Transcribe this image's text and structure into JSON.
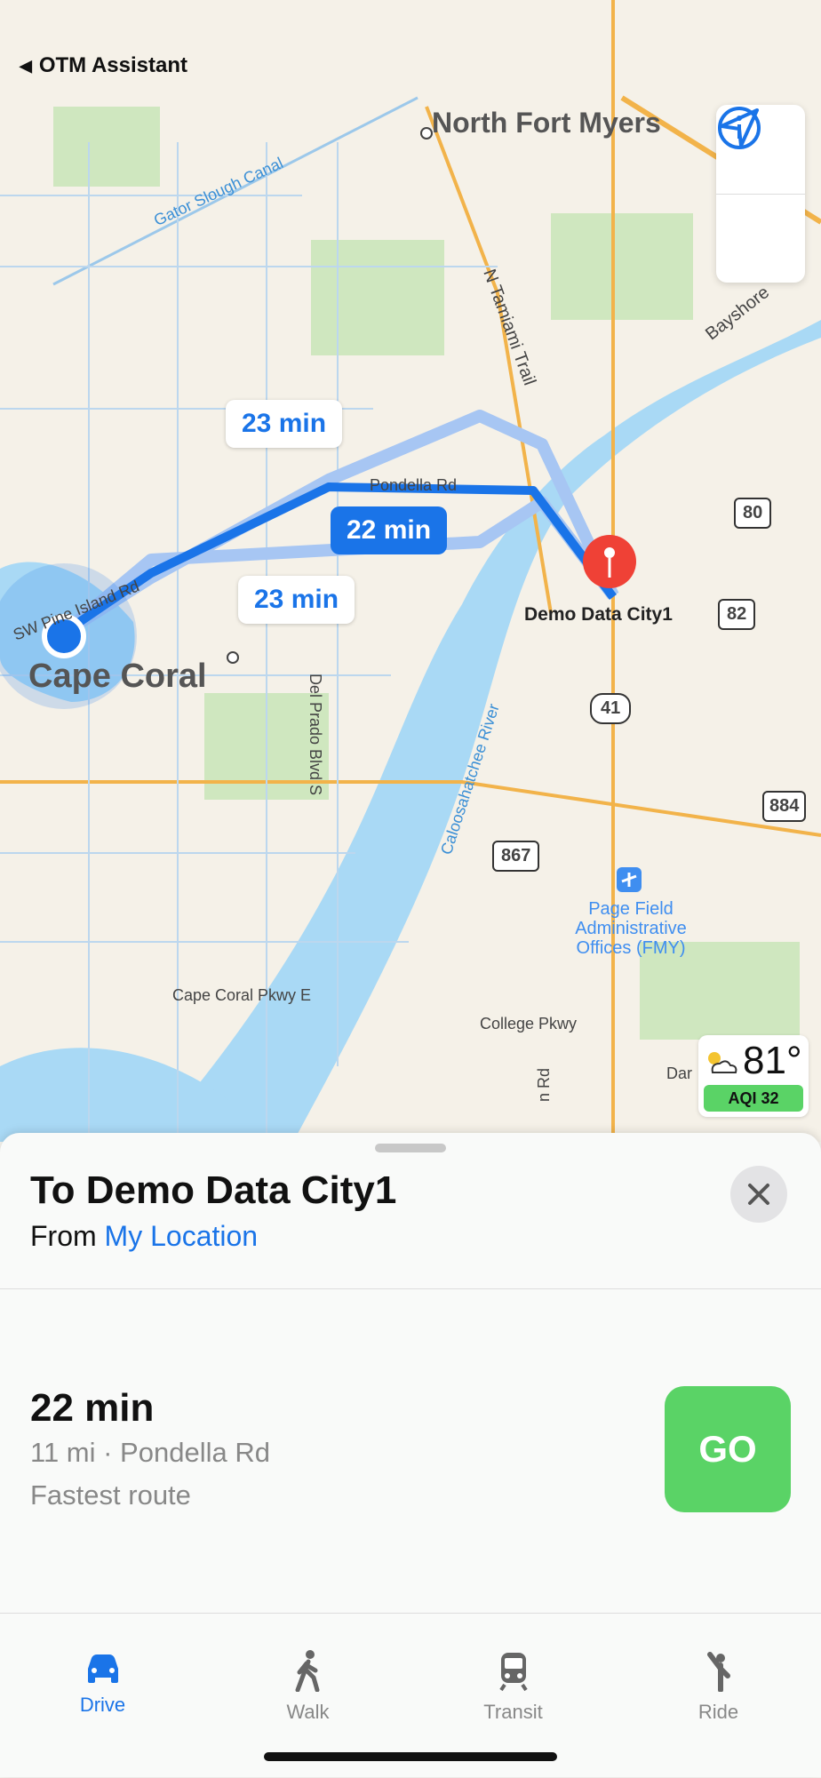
{
  "status_bar": {
    "back_label": "OTM Assistant"
  },
  "map": {
    "labels": {
      "north_fort_myers": "North Fort Myers",
      "gator_canal": "Gator Slough Canal",
      "tamiami": "N Tamiami Trail",
      "bayshore": "Bayshore",
      "pondella_rd": "Pondella Rd",
      "pine_island": "SW Pine Island Rd",
      "cape_coral": "Cape Coral",
      "del_prado": "Del Prado Blvd S",
      "river": "Caloosahatchee River",
      "airport": [
        "Page Field",
        "Administrative",
        "Offices (FMY)"
      ],
      "cape_coral_pkwy": "Cape Coral Pkwy E",
      "college_pkwy": "College Pkwy",
      "destination_pin": "Demo Data City1",
      "dar": "Dar",
      "rd": "n Rd"
    },
    "shields": [
      "80",
      "82",
      "41",
      "884",
      "867"
    ],
    "etas": {
      "alt1": "23 min",
      "main": "22 min",
      "alt2": "23 min"
    },
    "weather": {
      "temp": "81°",
      "aqi": "AQI 32"
    },
    "colors": {
      "route": "#1a74e8",
      "alt_route": "#a7c6f3",
      "water": "#a9d9f5"
    }
  },
  "sheet": {
    "title": "To Demo Data City1",
    "from_prefix": "From",
    "from_link": "My Location",
    "route": {
      "time": "22 min",
      "details": "11 mi · Pondella Rd",
      "note": "Fastest route",
      "go_label": "GO"
    }
  },
  "tabs": [
    {
      "label": "Drive",
      "icon": "car-icon",
      "active": true
    },
    {
      "label": "Walk",
      "icon": "walk-icon",
      "active": false
    },
    {
      "label": "Transit",
      "icon": "train-icon",
      "active": false
    },
    {
      "label": "Ride",
      "icon": "hail-icon",
      "active": false
    }
  ]
}
